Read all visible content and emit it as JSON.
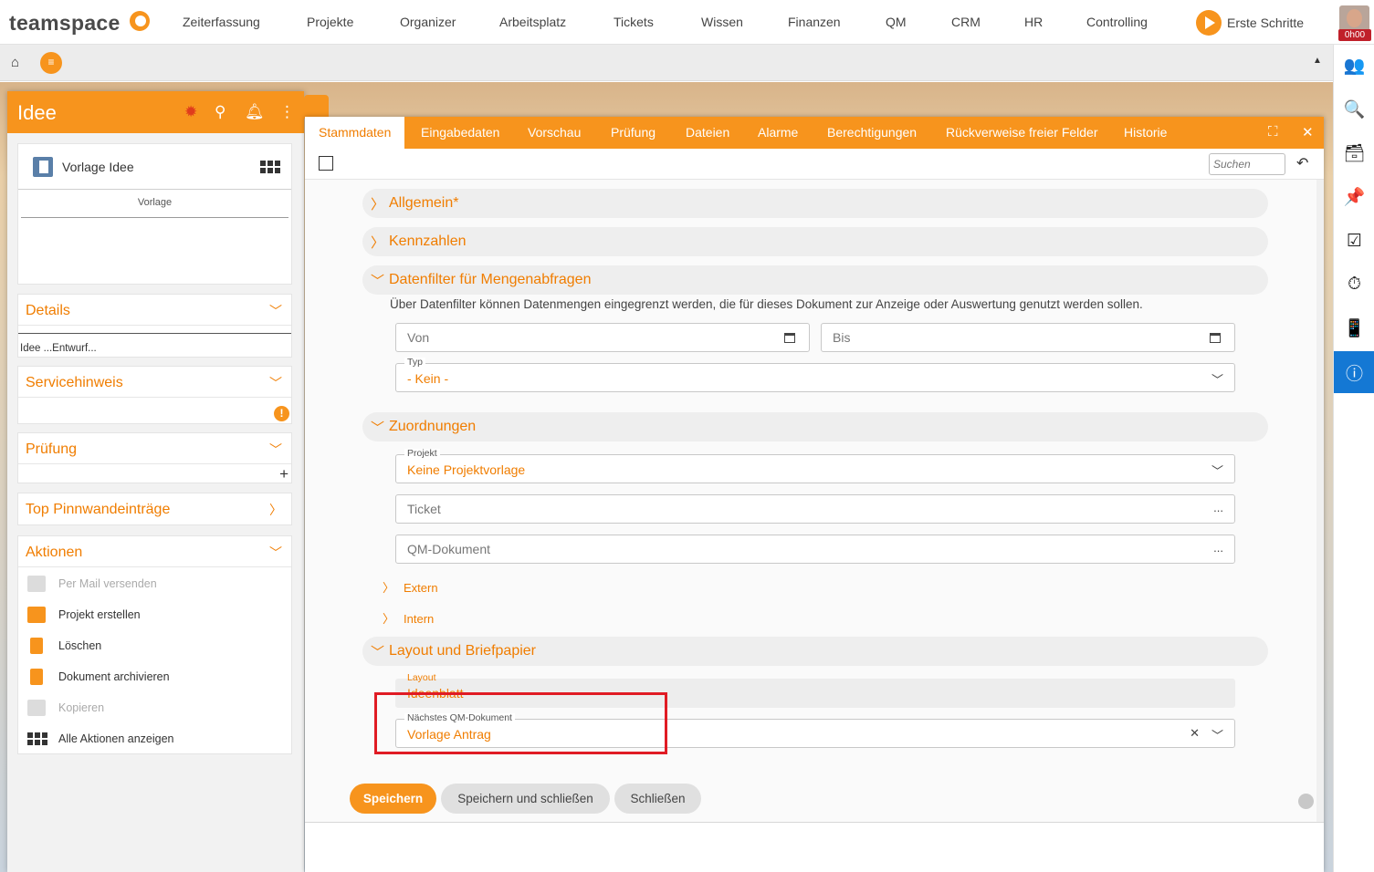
{
  "app": {
    "logo": "teamspace",
    "nav": [
      "Zeiterfassung",
      "Projekte",
      "Organizer",
      "Arbeitsplatz",
      "Tickets",
      "Wissen",
      "Finanzen",
      "QM",
      "CRM",
      "HR",
      "Controlling"
    ],
    "erste_schritte": "Erste Schritte",
    "timer": "0h00",
    "accent": "#f7941d"
  },
  "subbar": {
    "home_icon": "⌂",
    "menu_icon": "≡",
    "collapse_icon": "▲"
  },
  "rightbar": {
    "icons": [
      "users-icon",
      "search-icon",
      "inbox-icon",
      "pin-icon",
      "tasks-icon",
      "stopwatch-icon",
      "mobile-icon",
      "info-icon"
    ],
    "glyphs": [
      "👥",
      "🔍",
      "🗃",
      "📌",
      "☑",
      "⏱",
      "📱",
      "ⓘ"
    ]
  },
  "left_panel": {
    "title": "Idee",
    "vorlage": {
      "title": "Vorlage Idee",
      "subtitle": "Vorlage"
    },
    "details": {
      "title": "Details",
      "content": "Idee ...Entwurf..."
    },
    "servicehinweis": {
      "title": "Servicehinweis"
    },
    "pruefung": {
      "title": "Prüfung",
      "add": "+"
    },
    "pinnwand": {
      "title": "Top Pinnwandeinträge"
    },
    "aktionen": {
      "title": "Aktionen",
      "items": [
        {
          "label": "Per Mail versenden",
          "disabled": true
        },
        {
          "label": "Projekt erstellen",
          "disabled": false
        },
        {
          "label": "Löschen",
          "disabled": false
        },
        {
          "label": "Dokument archivieren",
          "disabled": false
        },
        {
          "label": "Kopieren",
          "disabled": true
        },
        {
          "label": "Alle Aktionen anzeigen",
          "disabled": false
        }
      ]
    }
  },
  "form": {
    "tabs": [
      "Stammdaten",
      "Eingabedaten",
      "Vorschau",
      "Prüfung",
      "Dateien",
      "Alarme",
      "Berechtigungen",
      "Rückverweise freier Felder",
      "Historie"
    ],
    "active_tab": "Stammdaten",
    "search_placeholder": "Suchen",
    "sections": {
      "allgemein": "Allgemein*",
      "kennzahlen": "Kennzahlen",
      "datenfilter": "Datenfilter für Mengenabfragen",
      "zuordnungen": "Zuordnungen",
      "layout": "Layout und Briefpapier"
    },
    "datenfilter_desc": "Über Datenfilter können Datenmengen eingegrenzt werden, die für dieses Dokument zur Anzeige oder Auswertung genutzt werden sollen.",
    "von": "Von",
    "bis": "Bis",
    "typ": {
      "label": "Typ",
      "value": "- Kein -"
    },
    "projekt": {
      "label": "Projekt",
      "value": "Keine Projektvorlage"
    },
    "ticket": "Ticket",
    "qm_dokument": "QM-Dokument",
    "ellipsis": "...",
    "extern": "Extern",
    "intern": "Intern",
    "layout_field": {
      "label": "Layout",
      "value": "Ideenblatt"
    },
    "next_qm": {
      "label": "Nächstes QM-Dokument",
      "value": "Vorlage Antrag"
    },
    "buttons": {
      "save": "Speichern",
      "save_close": "Speichern und schließen",
      "close": "Schließen"
    }
  }
}
